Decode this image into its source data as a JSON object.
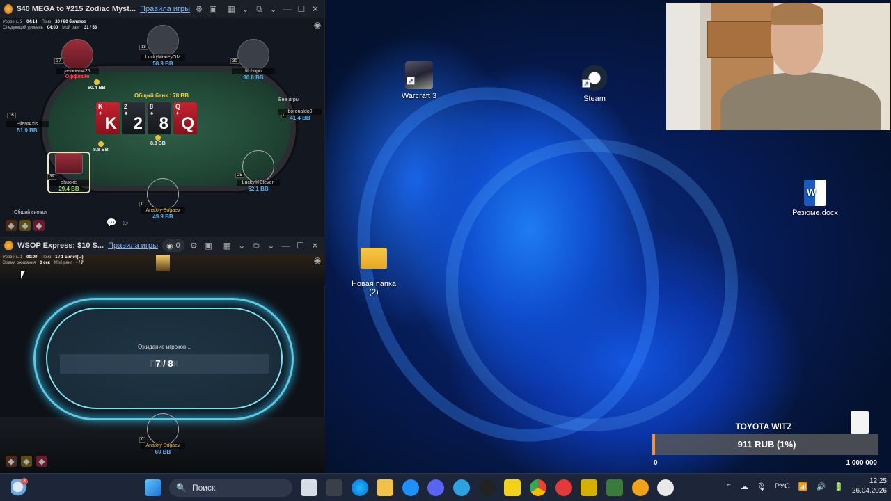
{
  "desktop": {
    "icons": [
      {
        "label": "Warcraft 3"
      },
      {
        "label": "Steam"
      },
      {
        "label": "Новая папка\n(2)"
      },
      {
        "label": "Резюме.docx"
      }
    ]
  },
  "window1": {
    "title": "$40 MEGA to ¥215 Zodiac Myst...",
    "rules_link": "Правила игры",
    "info": {
      "level_label": "Уровень 3",
      "level_time": "04:14",
      "prize_label": "Приз",
      "prize_value": "20 / 50 билетов",
      "next_label": "Следующий уровень",
      "next_time": "04:00",
      "rank_label": "Мой ранг",
      "rank_value": "31 / 53"
    },
    "pot": "Общий банк : 78 BB",
    "board": [
      {
        "rank": "K",
        "suit": "♦",
        "color": "red"
      },
      {
        "rank": "2",
        "suit": "♠",
        "color": "black"
      },
      {
        "rank": "8",
        "suit": "♠",
        "color": "black"
      },
      {
        "rank": "Q",
        "suit": "♦",
        "color": "red"
      }
    ],
    "pot_chips": "8.8 BB",
    "players": [
      {
        "name": "LuckyMoneyOM",
        "stack": "58.9 BB",
        "level": "18"
      },
      {
        "name": "jasonwu425",
        "stack": "",
        "level": "37",
        "status": "Оффлайн"
      },
      {
        "name": "lilchopo",
        "stack": "30.8 BB",
        "level": "30"
      },
      {
        "name": "SilentAxis",
        "stack": "51.9 BB",
        "level": "16"
      },
      {
        "name": "boronaldo9",
        "stack": "41.4 BB",
        "level": "0",
        "status": "Вне игры"
      },
      {
        "name": "shuoke",
        "stack": "29.4 BB",
        "level": "39"
      },
      {
        "name": "Lucky@Eleven",
        "stack": "52.1 BB",
        "level": "25"
      },
      {
        "name": "Anatoly Bugaev",
        "stack": "49.9 BB",
        "level": "0"
      }
    ],
    "bets": {
      "jasonwu": "60.4 BB",
      "shuoke": "8.8 BB"
    },
    "chat_label": "Общий сигнал"
  },
  "window2": {
    "title": "WSOP Express: $10 S...",
    "rules_link": "Правила игры",
    "watchers": "0",
    "info": {
      "level_label": "Уровень 1",
      "level_time": "00:00",
      "prize_label": "Приз",
      "prize_value": "1 / 1 Билет(ы)",
      "next_label": "Время ожидания",
      "next_time": "0 сек",
      "rank_label": "Мой ранг",
      "rank_value": "- / 7"
    },
    "waiting": "Ожидание игроков...",
    "ghost_text": "ПО      ОК",
    "count": "7 / 8",
    "hero": {
      "name": "Anatoly Bugaev",
      "stack": "60 BB",
      "level": "0"
    }
  },
  "goal": {
    "title": "TOYOTA WITZ",
    "progress": "911 RUB (1%)",
    "progress_fraction": 0.01,
    "min": "0",
    "max": "1 000 000"
  },
  "taskbar": {
    "search_placeholder": "Поиск",
    "lang": "РУС",
    "time": "12:25",
    "date": "26.04.2026",
    "weather_badge": "3"
  },
  "colors": {
    "goal_accent": "#f7941d",
    "taskbar": "#1c2638"
  }
}
